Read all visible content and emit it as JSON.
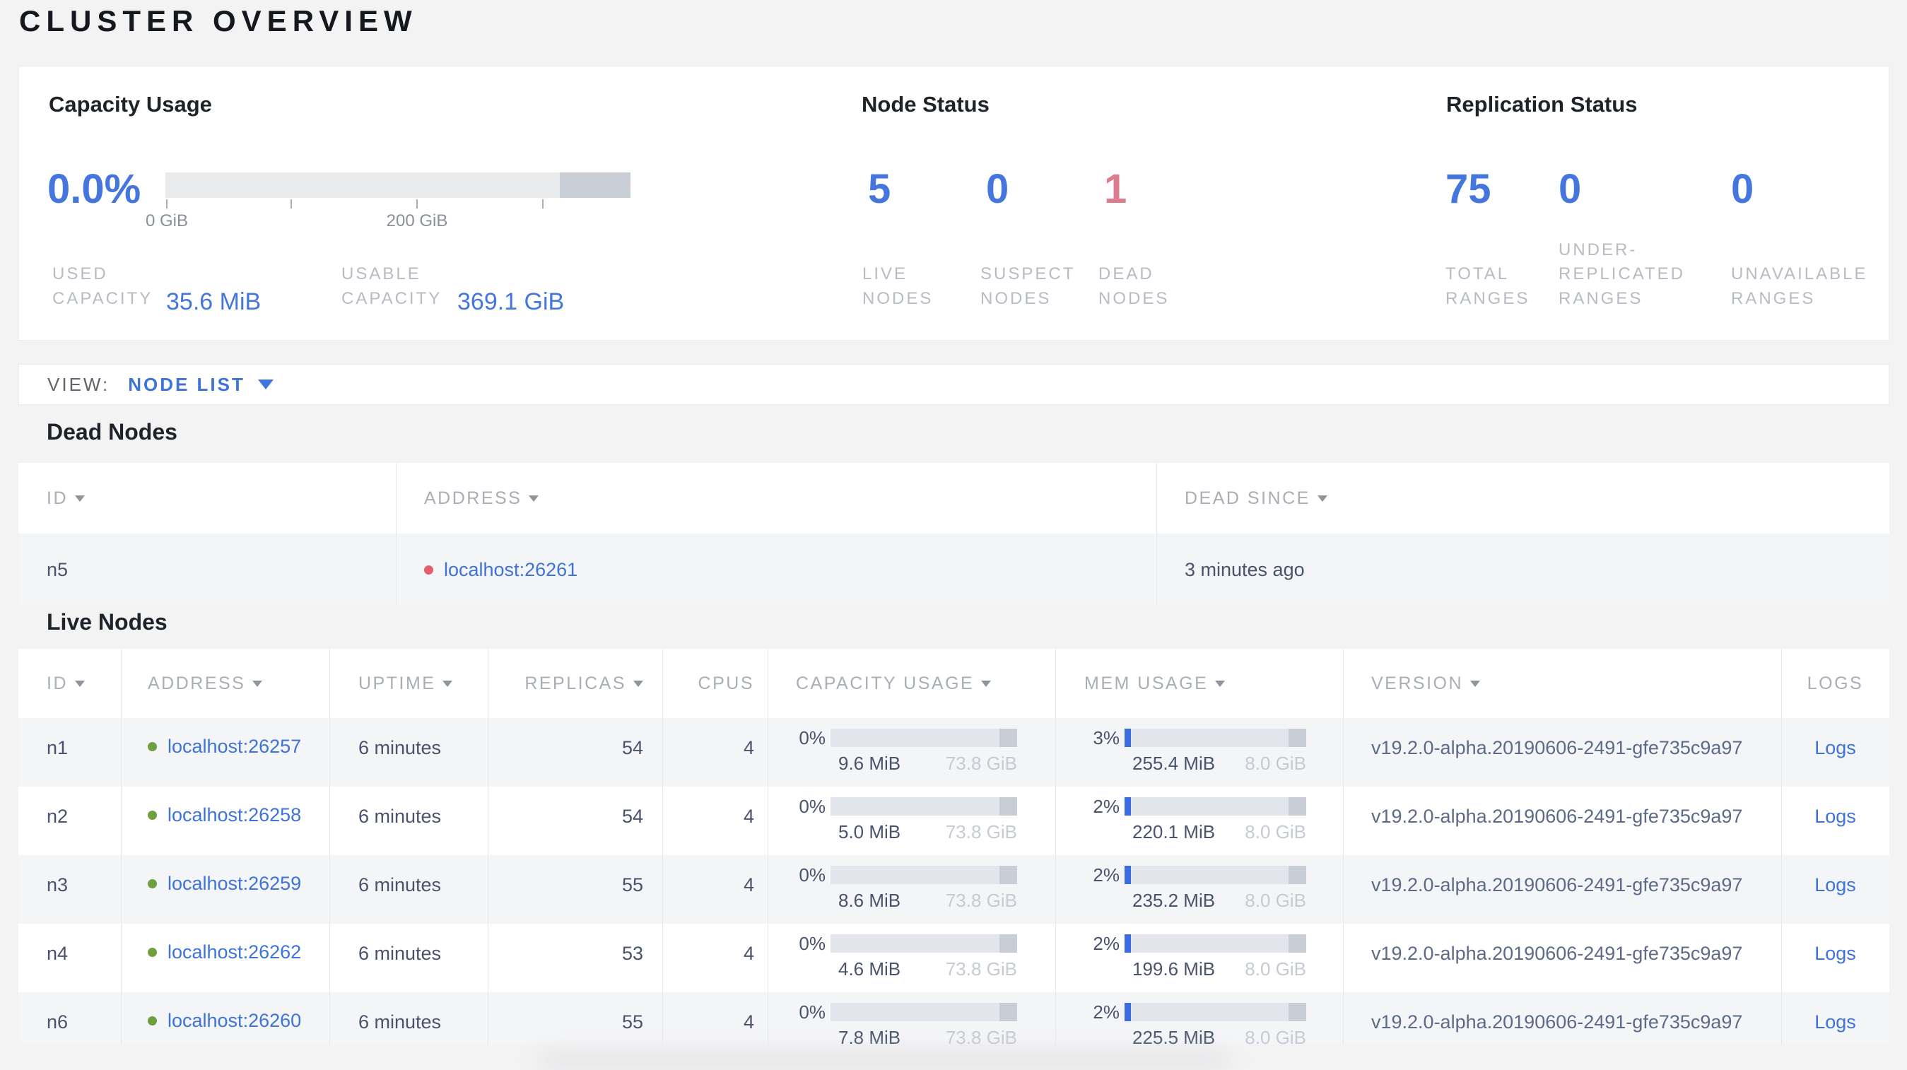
{
  "page": {
    "title": "CLUSTER OVERVIEW"
  },
  "colors": {
    "accent_blue": "#4576dd",
    "dead_red": "#dd7b8f",
    "link_blue": "#3d73da",
    "live_green": "#6f9f3e",
    "dead_dot_red": "#e25f6d"
  },
  "summary": {
    "capacity": {
      "heading": "Capacity Usage",
      "percent": "0.0%",
      "axis_ticks": [
        "0 GiB",
        "200 GiB"
      ],
      "used": {
        "label": "USED\nCAPACITY",
        "value": "35.6 MiB"
      },
      "usable": {
        "label": "USABLE\nCAPACITY",
        "value": "369.1 GiB"
      }
    },
    "node_status": {
      "heading": "Node Status",
      "stats": [
        {
          "value": "5",
          "label": "LIVE\nNODES",
          "color": "#4576dd"
        },
        {
          "value": "0",
          "label": "SUSPECT\nNODES",
          "color": "#4576dd"
        },
        {
          "value": "1",
          "label": "DEAD\nNODES",
          "color": "#dd7b8f"
        }
      ]
    },
    "replication": {
      "heading": "Replication Status",
      "stats": [
        {
          "value": "75",
          "label": "TOTAL\nRANGES",
          "color": "#4576dd"
        },
        {
          "value": "0",
          "label": "UNDER-\nREPLICATED\nRANGES",
          "color": "#4576dd"
        },
        {
          "value": "0",
          "label": "UNAVAILABLE\nRANGES",
          "color": "#4576dd"
        }
      ]
    }
  },
  "view_bar": {
    "label": "VIEW:",
    "selected": "NODE LIST"
  },
  "dead_nodes": {
    "heading": "Dead Nodes",
    "columns": [
      {
        "label": "ID"
      },
      {
        "label": "ADDRESS"
      },
      {
        "label": "DEAD SINCE"
      }
    ],
    "rows": [
      {
        "id": "n5",
        "address": "localhost:26261",
        "dead_since": "3 minutes ago"
      }
    ]
  },
  "live_nodes": {
    "heading": "Live Nodes",
    "columns": [
      {
        "label": "ID"
      },
      {
        "label": "ADDRESS"
      },
      {
        "label": "UPTIME"
      },
      {
        "label": "REPLICAS"
      },
      {
        "label": "CPUS"
      },
      {
        "label": "CAPACITY USAGE"
      },
      {
        "label": "MEM USAGE"
      },
      {
        "label": "VERSION"
      },
      {
        "label": "LOGS"
      }
    ],
    "rows": [
      {
        "id": "n1",
        "address": "localhost:26257",
        "uptime": "6 minutes",
        "replicas": "54",
        "cpus": "4",
        "capacity": {
          "percent": "0%",
          "pct": 0,
          "used": "9.6 MiB",
          "total": "73.8 GiB"
        },
        "mem": {
          "percent": "3%",
          "pct": 3,
          "used": "255.4 MiB",
          "total": "8.0 GiB"
        },
        "version": "v19.2.0-alpha.20190606-2491-gfe735c9a97",
        "logs": "Logs"
      },
      {
        "id": "n2",
        "address": "localhost:26258",
        "uptime": "6 minutes",
        "replicas": "54",
        "cpus": "4",
        "capacity": {
          "percent": "0%",
          "pct": 0,
          "used": "5.0 MiB",
          "total": "73.8 GiB"
        },
        "mem": {
          "percent": "2%",
          "pct": 2,
          "used": "220.1 MiB",
          "total": "8.0 GiB"
        },
        "version": "v19.2.0-alpha.20190606-2491-gfe735c9a97",
        "logs": "Logs"
      },
      {
        "id": "n3",
        "address": "localhost:26259",
        "uptime": "6 minutes",
        "replicas": "55",
        "cpus": "4",
        "capacity": {
          "percent": "0%",
          "pct": 0,
          "used": "8.6 MiB",
          "total": "73.8 GiB"
        },
        "mem": {
          "percent": "2%",
          "pct": 2,
          "used": "235.2 MiB",
          "total": "8.0 GiB"
        },
        "version": "v19.2.0-alpha.20190606-2491-gfe735c9a97",
        "logs": "Logs"
      },
      {
        "id": "n4",
        "address": "localhost:26262",
        "uptime": "6 minutes",
        "replicas": "53",
        "cpus": "4",
        "capacity": {
          "percent": "0%",
          "pct": 0,
          "used": "4.6 MiB",
          "total": "73.8 GiB"
        },
        "mem": {
          "percent": "2%",
          "pct": 2,
          "used": "199.6 MiB",
          "total": "8.0 GiB"
        },
        "version": "v19.2.0-alpha.20190606-2491-gfe735c9a97",
        "logs": "Logs"
      },
      {
        "id": "n6",
        "address": "localhost:26260",
        "uptime": "6 minutes",
        "replicas": "55",
        "cpus": "4",
        "capacity": {
          "percent": "0%",
          "pct": 0,
          "used": "7.8 MiB",
          "total": "73.8 GiB"
        },
        "mem": {
          "percent": "2%",
          "pct": 2,
          "used": "225.5 MiB",
          "total": "8.0 GiB"
        },
        "version": "v19.2.0-alpha.20190606-2491-gfe735c9a97",
        "logs": "Logs"
      }
    ]
  }
}
